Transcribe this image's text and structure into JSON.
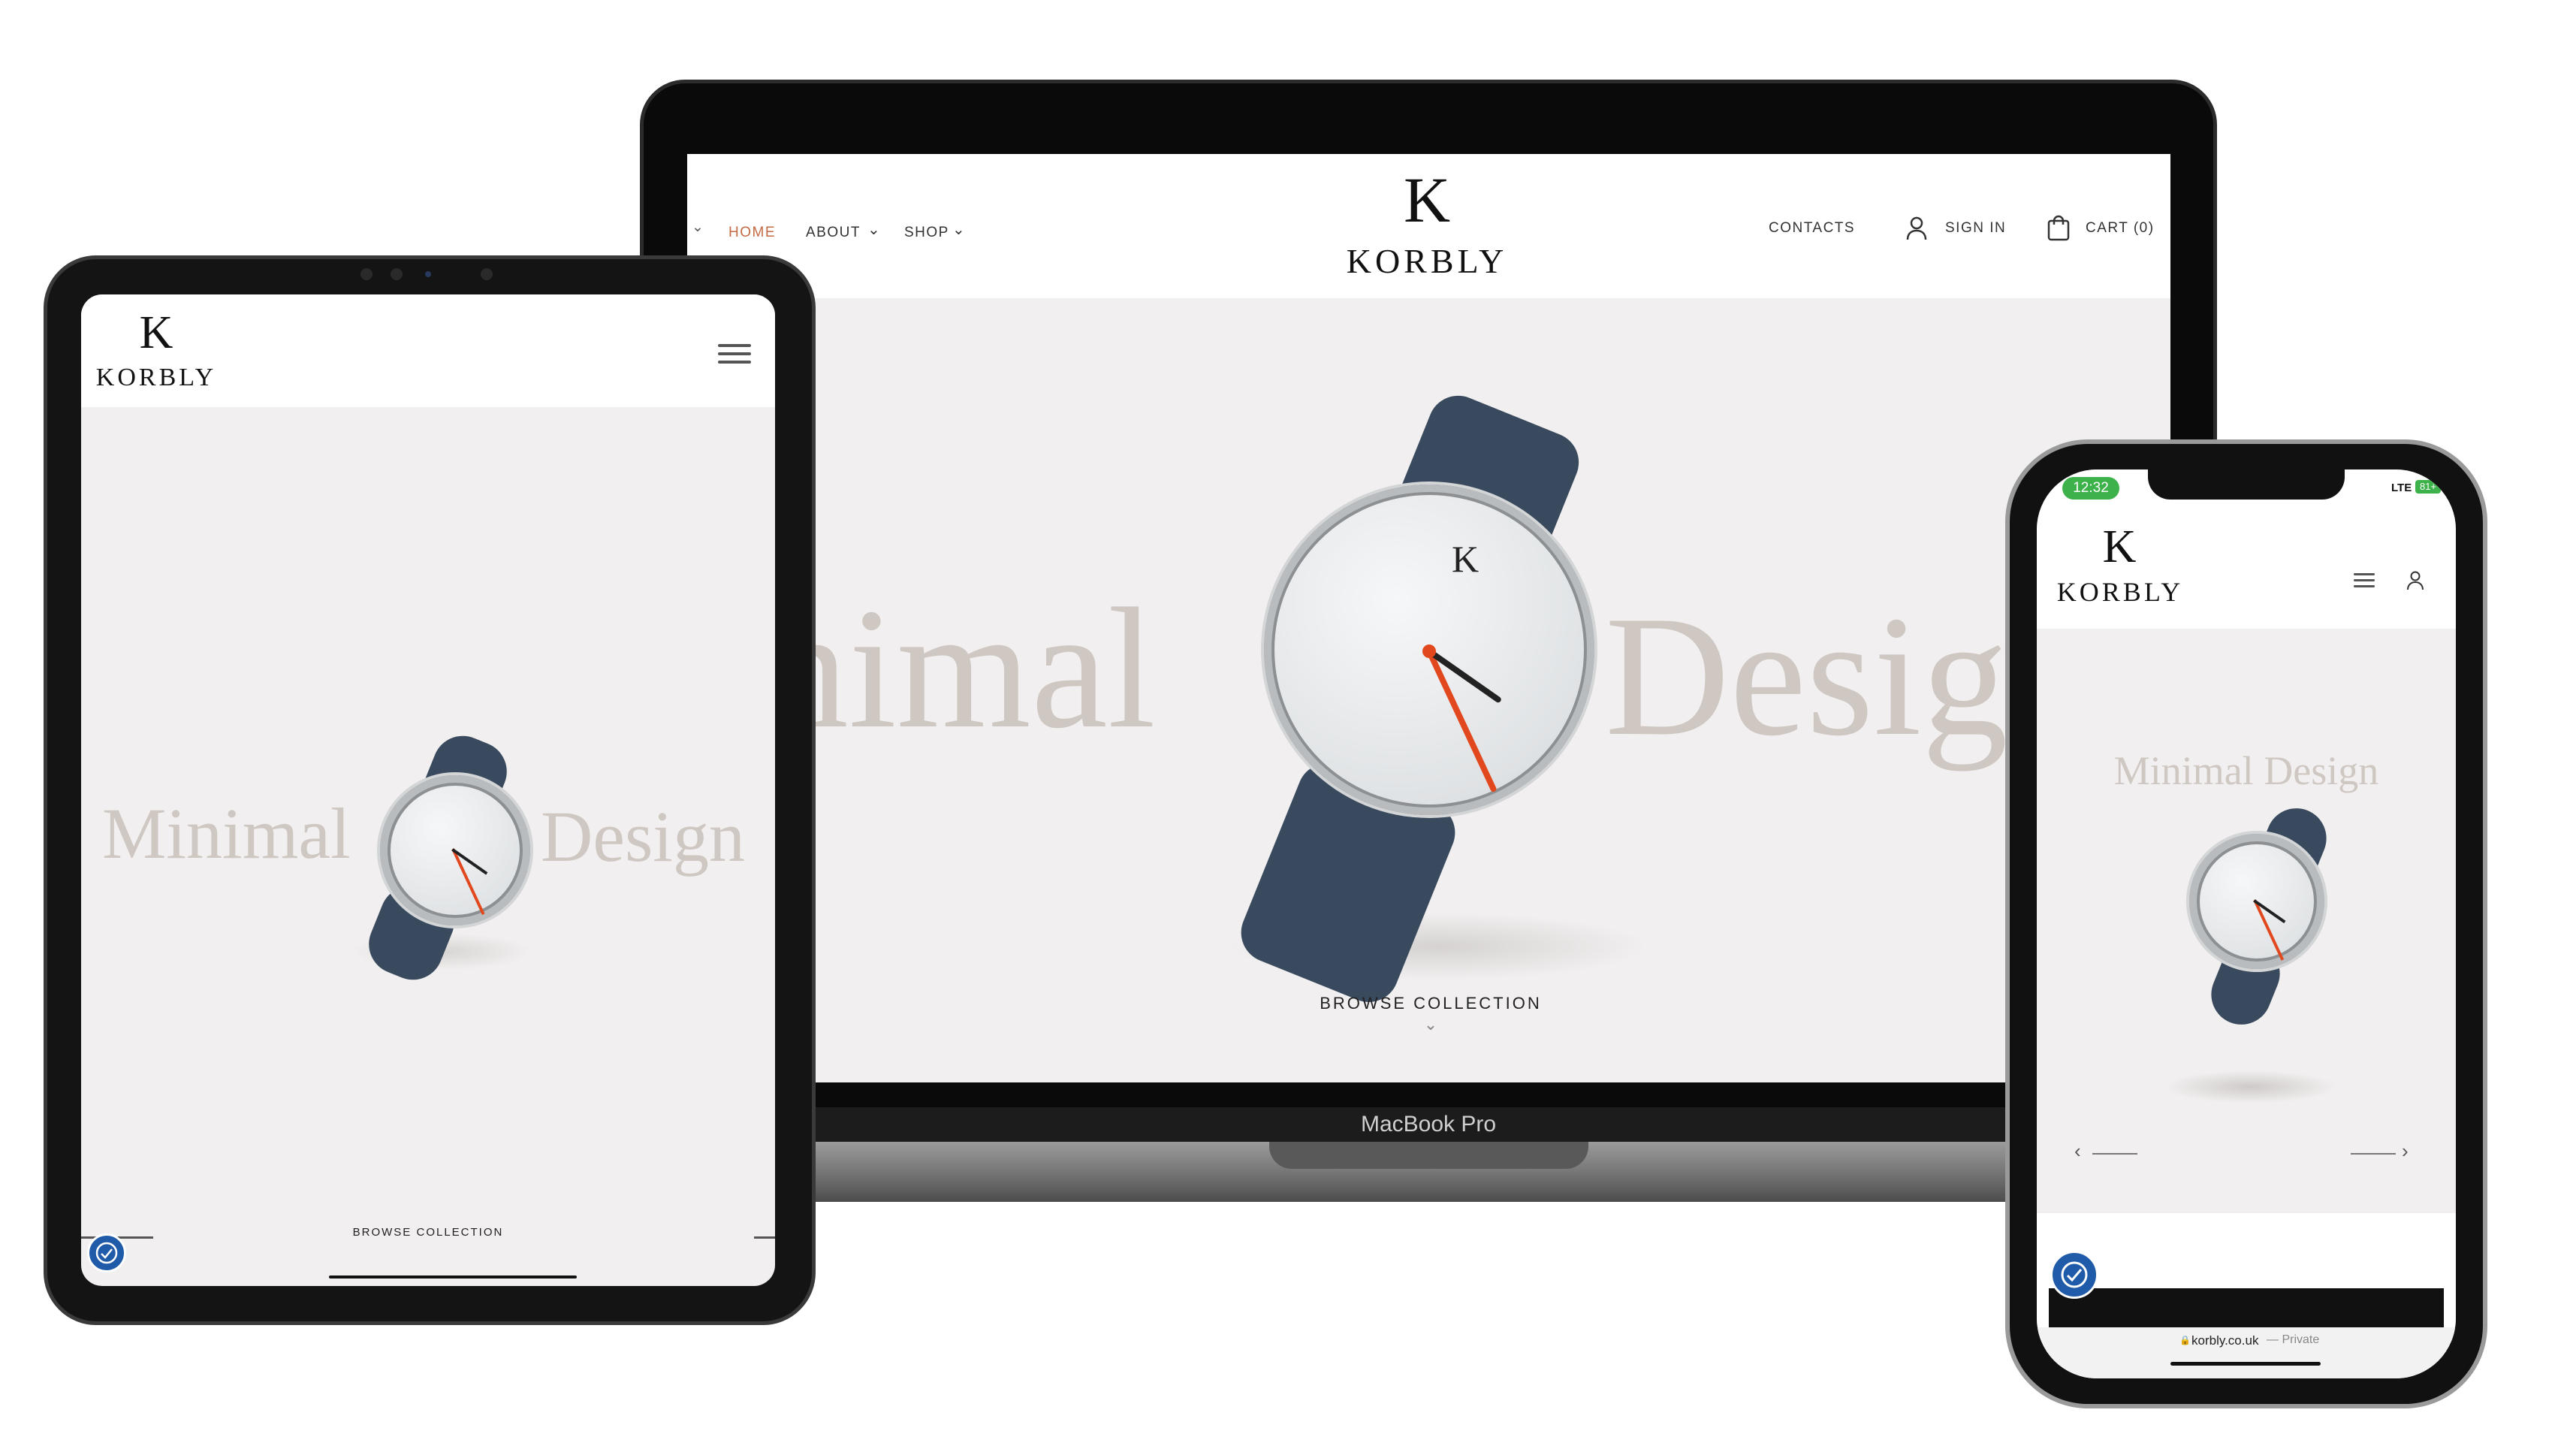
{
  "brand": {
    "name": "KORBLY",
    "monogram": "K"
  },
  "laptop": {
    "nav_left": [
      {
        "label": "HOME",
        "active": true
      },
      {
        "label": "ABOUT",
        "dropdown": true
      },
      {
        "label": "SHOP",
        "dropdown": true
      }
    ],
    "nav_right": {
      "contacts": "CONTACTS",
      "sign_in": "SIGN IN",
      "cart": "CART (0)"
    },
    "hero_text_left": "nimal",
    "hero_text_right": "Desig",
    "browse": "BROWSE COLLECTION",
    "device_label": "MacBook Pro"
  },
  "tablet": {
    "hero_text_left": "Minimal",
    "hero_text_right": "Design",
    "browse": "BROWSE COLLECTION"
  },
  "phone": {
    "time": "12:32",
    "network": "LTE",
    "battery": "81+",
    "hero_text": "Minimal Design",
    "url": "korbly.co.uk",
    "url_suffix": "— Private"
  },
  "colors": {
    "accent": "#c46a45",
    "hero_bg": "#f1efef",
    "hero_text": "#cfc8c2",
    "strap": "#3a4a5e",
    "badge": "#1f5ba8"
  },
  "icons": [
    "user-icon",
    "cart-icon",
    "hamburger-icon",
    "chevron-down-icon",
    "arrow-left-icon",
    "arrow-right-icon",
    "accessibility-icon",
    "lock-icon"
  ]
}
